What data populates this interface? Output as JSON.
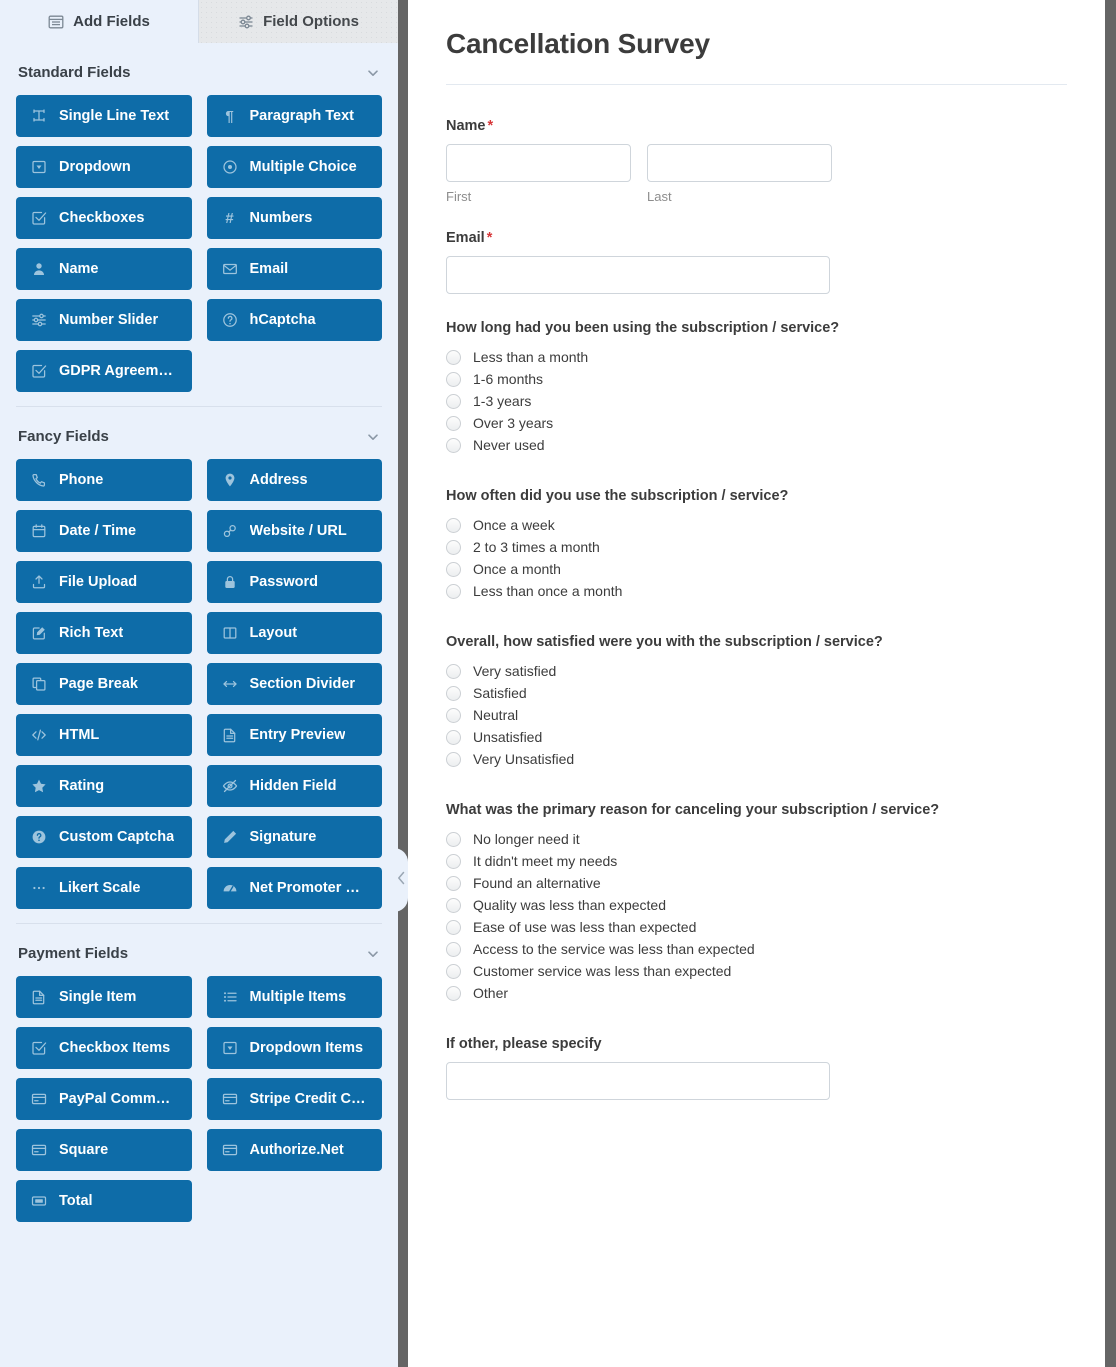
{
  "panel": {
    "tabs": [
      {
        "label": "Add Fields",
        "icon": "add-fields-icon",
        "active": true
      },
      {
        "label": "Field Options",
        "icon": "sliders-icon",
        "active": false
      }
    ],
    "sections": [
      {
        "title": "Standard Fields",
        "fields": [
          {
            "label": "Single Line Text",
            "icon": "text-cursor-icon"
          },
          {
            "label": "Paragraph Text",
            "icon": "pilcrow-icon"
          },
          {
            "label": "Dropdown",
            "icon": "dropdown-caret-icon"
          },
          {
            "label": "Multiple Choice",
            "icon": "radio-circle-icon"
          },
          {
            "label": "Checkboxes",
            "icon": "checkbox-check-icon"
          },
          {
            "label": "Numbers",
            "icon": "hash-icon"
          },
          {
            "label": "Name",
            "icon": "user-icon"
          },
          {
            "label": "Email",
            "icon": "envelope-icon"
          },
          {
            "label": "Number Slider",
            "icon": "sliders-icon"
          },
          {
            "label": "hCaptcha",
            "icon": "question-circle-icon"
          },
          {
            "label": "GDPR Agreement",
            "icon": "checkbox-check-icon"
          }
        ]
      },
      {
        "title": "Fancy Fields",
        "fields": [
          {
            "label": "Phone",
            "icon": "phone-icon"
          },
          {
            "label": "Address",
            "icon": "map-pin-icon"
          },
          {
            "label": "Date / Time",
            "icon": "calendar-icon"
          },
          {
            "label": "Website / URL",
            "icon": "link-icon"
          },
          {
            "label": "File Upload",
            "icon": "upload-icon"
          },
          {
            "label": "Password",
            "icon": "lock-icon"
          },
          {
            "label": "Rich Text",
            "icon": "pencil-square-icon"
          },
          {
            "label": "Layout",
            "icon": "columns-icon"
          },
          {
            "label": "Page Break",
            "icon": "pages-icon"
          },
          {
            "label": "Section Divider",
            "icon": "arrows-horizontal-icon"
          },
          {
            "label": "HTML",
            "icon": "code-icon"
          },
          {
            "label": "Entry Preview",
            "icon": "document-icon"
          },
          {
            "label": "Rating",
            "icon": "star-icon"
          },
          {
            "label": "Hidden Field",
            "icon": "eye-slash-icon"
          },
          {
            "label": "Custom Captcha",
            "icon": "question-circle-filled-icon"
          },
          {
            "label": "Signature",
            "icon": "pencil-icon"
          },
          {
            "label": "Likert Scale",
            "icon": "dots-icon"
          },
          {
            "label": "Net Promoter Score",
            "icon": "gauge-icon"
          }
        ]
      },
      {
        "title": "Payment Fields",
        "fields": [
          {
            "label": "Single Item",
            "icon": "document-icon"
          },
          {
            "label": "Multiple Items",
            "icon": "list-icon"
          },
          {
            "label": "Checkbox Items",
            "icon": "checkbox-check-icon"
          },
          {
            "label": "Dropdown Items",
            "icon": "dropdown-caret-icon"
          },
          {
            "label": "PayPal Commerce",
            "icon": "credit-card-icon"
          },
          {
            "label": "Stripe Credit Card",
            "icon": "credit-card-icon"
          },
          {
            "label": "Square",
            "icon": "credit-card-icon"
          },
          {
            "label": "Authorize.Net",
            "icon": "credit-card-icon"
          },
          {
            "label": "Total",
            "icon": "money-icon"
          }
        ]
      }
    ],
    "collapse_icon": "chevron-left-icon"
  },
  "form": {
    "title": "Cancellation Survey",
    "name_field": {
      "label": "Name",
      "required_marker": "*",
      "first_sublabel": "First",
      "last_sublabel": "Last",
      "first_value": "",
      "last_value": ""
    },
    "email_field": {
      "label": "Email",
      "required_marker": "*",
      "value": ""
    },
    "questions": [
      {
        "title": "How long had you been using the subscription / service?",
        "options": [
          "Less than a month",
          "1-6 months",
          "1-3 years",
          "Over 3 years",
          "Never used"
        ]
      },
      {
        "title": "How often did you use the subscription / service?",
        "options": [
          "Once a week",
          "2 to 3 times a month",
          "Once a month",
          "Less than once a month"
        ]
      },
      {
        "title": "Overall, how satisfied were you with the subscription / service?",
        "options": [
          "Very satisfied",
          "Satisfied",
          "Neutral",
          "Unsatisfied",
          "Very Unsatisfied"
        ]
      },
      {
        "title": "What was the primary reason for canceling your subscription / service?",
        "options": [
          "No longer need it",
          "It didn't meet my needs",
          "Found an alternative",
          "Quality was less than expected",
          "Ease of use was less than expected",
          "Access to the service was less than expected",
          "Customer service was less than expected",
          "Other"
        ]
      }
    ],
    "other_field": {
      "label": "If other, please specify",
      "value": ""
    }
  },
  "colors": {
    "field_button": "#0e6ca8",
    "panel_background": "#eaf1fb",
    "required": "#d63638",
    "divider": "#656565"
  }
}
